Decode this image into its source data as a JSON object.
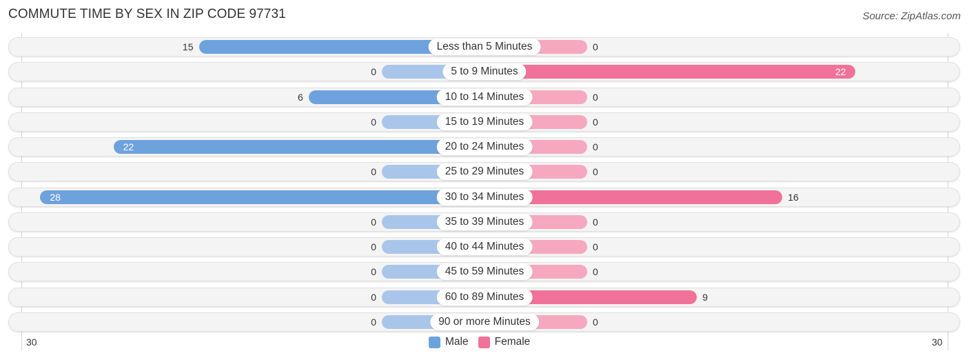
{
  "title": "COMMUTE TIME BY SEX IN ZIP CODE 97731",
  "source": "Source: ZipAtlas.com",
  "colors": {
    "male": "#6ea2dd",
    "female": "#f0719a",
    "male_zero": "#a9c6ea",
    "female_zero": "#f5a8c0"
  },
  "chart_data": {
    "type": "bar",
    "orientation": "horizontal-diverging",
    "title": "COMMUTE TIME BY SEX IN ZIP CODE 97731",
    "categories": [
      "Less than 5 Minutes",
      "5 to 9 Minutes",
      "10 to 14 Minutes",
      "15 to 19 Minutes",
      "20 to 24 Minutes",
      "25 to 29 Minutes",
      "30 to 34 Minutes",
      "35 to 39 Minutes",
      "40 to 44 Minutes",
      "45 to 59 Minutes",
      "60 to 89 Minutes",
      "90 or more Minutes"
    ],
    "series": [
      {
        "name": "Male",
        "values": [
          15,
          0,
          6,
          0,
          22,
          0,
          28,
          0,
          0,
          0,
          0,
          0
        ]
      },
      {
        "name": "Female",
        "values": [
          0,
          22,
          0,
          0,
          0,
          0,
          16,
          0,
          0,
          0,
          9,
          0
        ]
      }
    ],
    "axis": {
      "left_tick": "30",
      "right_tick": "30",
      "max": 30
    },
    "legend": {
      "position": "bottom-center",
      "entries": [
        "Male",
        "Female"
      ]
    },
    "grid": false
  }
}
